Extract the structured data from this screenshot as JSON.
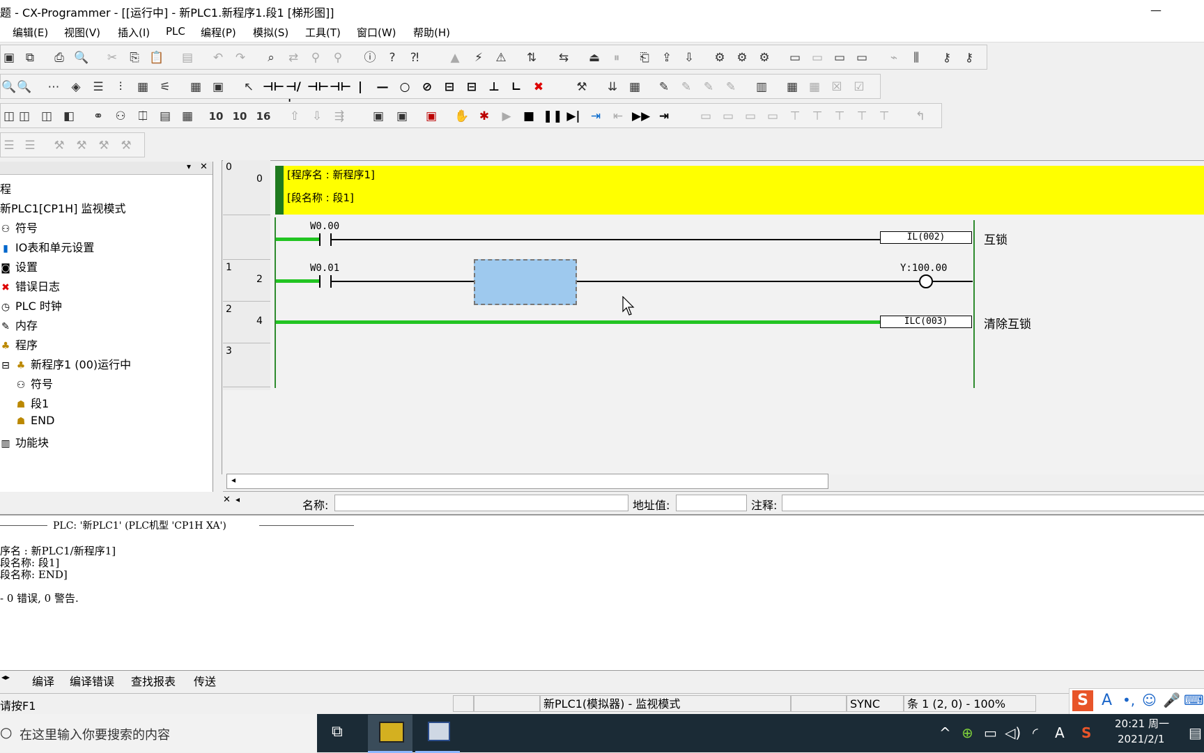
{
  "window": {
    "title": "题 - CX-Programmer - [[运行中] - 新PLC1.新程序1.段1 [梯形图]]",
    "minimize_glyph": "—"
  },
  "menu": [
    "编辑(E)",
    "视图(V)",
    "插入(I)",
    "PLC",
    "编程(P)",
    "模拟(S)",
    "工具(T)",
    "窗口(W)",
    "帮助(H)"
  ],
  "toolbar": {
    "bit_labels": [
      "10",
      "10",
      "16"
    ]
  },
  "tree": {
    "items": [
      {
        "label": "程",
        "icon": "project-icon"
      },
      {
        "label": "新PLC1[CP1H] 监视模式",
        "icon": "plc-icon"
      },
      {
        "label": "符号",
        "icon": "symbols-icon"
      },
      {
        "label": "IO表和单元设置",
        "icon": "io-table-icon"
      },
      {
        "label": "设置",
        "icon": "settings-icon"
      },
      {
        "label": "错误日志",
        "icon": "error-log-icon"
      },
      {
        "label": "PLC 时钟",
        "icon": "clock-icon"
      },
      {
        "label": "内存",
        "icon": "memory-icon"
      },
      {
        "label": "程序",
        "icon": "programs-icon"
      },
      {
        "label": "新程序1 (00)运行中",
        "icon": "program-icon"
      },
      {
        "label": "符号",
        "icon": "symbols-icon"
      },
      {
        "label": "段1",
        "icon": "section-icon"
      },
      {
        "label": "END",
        "icon": "section-icon"
      },
      {
        "label": "功能块",
        "icon": "function-block-icon"
      }
    ]
  },
  "ladder": {
    "row_numbers": [
      "0",
      "1",
      "2",
      "3"
    ],
    "step_numbers": [
      "0",
      "2",
      "4"
    ],
    "header": {
      "program_name": "[程序名 : 新程序1]",
      "section_name": "[段名称 : 段1]"
    },
    "rungs": [
      {
        "contact": "W0.00",
        "instruction": "IL(002)",
        "comment": "互锁"
      },
      {
        "contact": "W0.01",
        "coil": "Y:100.00"
      },
      {
        "instruction": "ILC(003)",
        "comment": "清除互锁"
      }
    ]
  },
  "fields": {
    "name_label": "名称:",
    "address_label": "地址值:",
    "comment_label": "注释:"
  },
  "output": {
    "header": "PLC: '新PLC1' (PLC机型 'CP1H XA')",
    "lines": [
      "序名 : 新PLC1/新程序1]",
      "段名称: 段1]",
      "段名称: END]",
      "- 0 错误, 0 警告."
    ]
  },
  "output_tabs": [
    "编译",
    "编译错误",
    "查找报表",
    "传送"
  ],
  "status": {
    "help": "请按F1",
    "mode": "新PLC1(模拟器) - 监视模式",
    "sync": "SYNC",
    "position": "条 1 (2, 0)  - 100%"
  },
  "taskbar": {
    "search_placeholder": "在这里输入你要搜索的内容",
    "time": "20:21 周一",
    "date": "2021/2/1"
  },
  "colors": {
    "header_yellow": "#ffff00",
    "power_green": "#22c422",
    "selection_blue": "#9ec9ee"
  }
}
